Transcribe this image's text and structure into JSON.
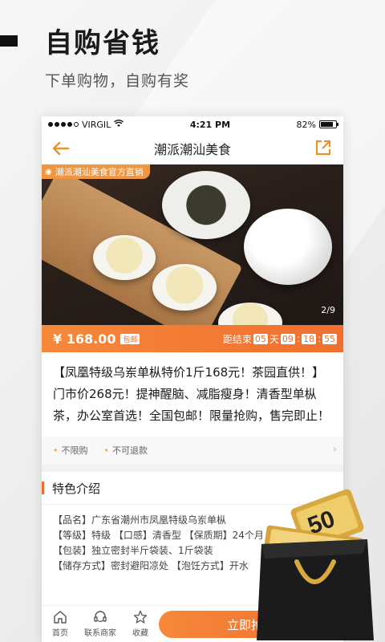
{
  "promo": {
    "title": "自购省钱",
    "subtitle": "下单购物，自购有奖"
  },
  "status_bar": {
    "carrier": "VIRGIL",
    "time": "4:21 PM",
    "battery": "82%",
    "battery_level": 0.82
  },
  "navbar": {
    "title": "潮派潮汕美食"
  },
  "hero": {
    "shop_tag": "潮派潮汕美食官方直销",
    "counter": "2/9"
  },
  "price_bar": {
    "price": "¥ 168.00",
    "free_shipping": "包邮",
    "countdown_label": "距结束",
    "days": "05",
    "days_unit": "天",
    "hours": "09",
    "minutes": "18",
    "seconds": "55",
    "sep": ":"
  },
  "product": {
    "description": "【凤凰特级乌岽单枞特价1斤168元！茶园直供！】门市价268元！提神醒脑、减脂瘦身！清香型单枞茶，办公室首选！全国包邮！限量抢购，售完即止！"
  },
  "tags": [
    "不限购",
    "不可退款"
  ],
  "feature": {
    "heading": "特色介绍",
    "lines": [
      "【品名】广东省潮州市凤凰特级乌岽单枞",
      "【等级】特级 【口感】清香型 【保质期】24个月",
      "【包装】独立密封半斤袋装、1斤袋装",
      "【储存方式】密封避阳凉处 【泡饪方式】开水"
    ]
  },
  "bottom_bar": {
    "home": "首页",
    "contact": "联系商家",
    "favorite": "收藏",
    "buy": "立即抢购"
  },
  "bag": {
    "value": "50"
  }
}
